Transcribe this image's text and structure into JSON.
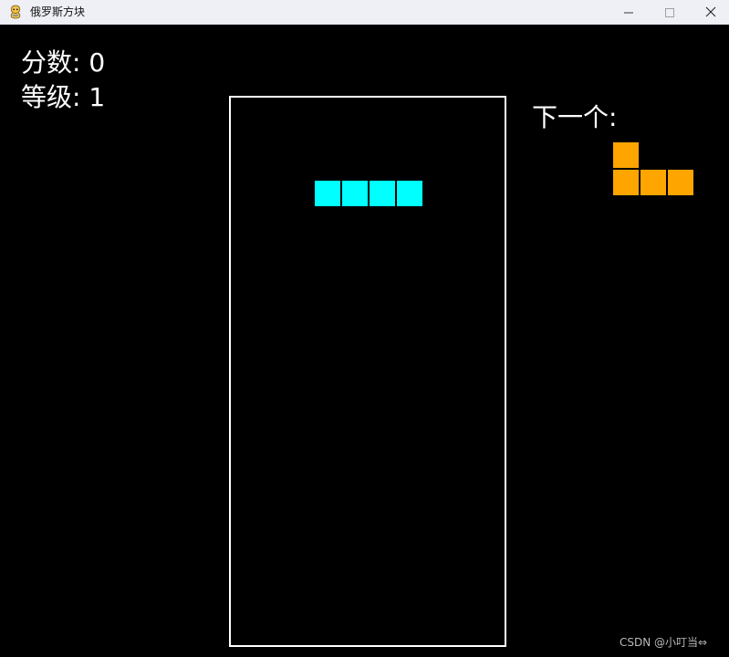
{
  "window": {
    "title": "俄罗斯方块",
    "app_icon": "pygame-snake-icon",
    "controls": {
      "minimize_icon": "minimize-icon",
      "maximize_icon": "maximize-icon",
      "close_icon": "close-icon"
    }
  },
  "hud": {
    "score_label": "分数: 0",
    "level_label": "等级: 1",
    "next_label": "下一个:"
  },
  "board": {
    "columns": 10,
    "rows": 20,
    "border_color": "#ffffff",
    "active_piece": {
      "shape": "I",
      "color": "#00ffff",
      "cells": [
        [
          3,
          3
        ],
        [
          4,
          3
        ],
        [
          5,
          3
        ],
        [
          6,
          3
        ]
      ]
    }
  },
  "next_piece": {
    "shape": "J",
    "color": "#ffa500",
    "cells": [
      [
        0,
        0
      ],
      [
        0,
        1
      ],
      [
        1,
        1
      ],
      [
        2,
        1
      ]
    ]
  },
  "watermark": "CSDN @小叮当⇔"
}
